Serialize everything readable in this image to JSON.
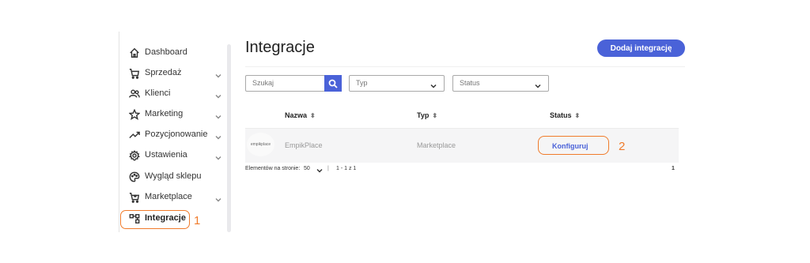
{
  "sidebar": {
    "items": [
      {
        "label": "Dashboard",
        "icon": "home-icon",
        "chevron": false
      },
      {
        "label": "Sprzedaż",
        "icon": "cart-icon",
        "chevron": true
      },
      {
        "label": "Klienci",
        "icon": "users-icon",
        "chevron": true
      },
      {
        "label": "Marketing",
        "icon": "star-icon",
        "chevron": true
      },
      {
        "label": "Pozycjonowanie",
        "icon": "trending-up-icon",
        "chevron": true
      },
      {
        "label": "Ustawienia",
        "icon": "gear-icon",
        "chevron": true
      },
      {
        "label": "Wygląd sklepu",
        "icon": "palette-icon",
        "chevron": false
      },
      {
        "label": "Marketplace",
        "icon": "marketplace-cart-icon",
        "chevron": true
      },
      {
        "label": "Integracje",
        "icon": "integrations-icon",
        "chevron": false,
        "active": true
      }
    ],
    "annotation": "1"
  },
  "main": {
    "title": "Integracje",
    "add_button": "Dodaj integrację",
    "filters": {
      "search_placeholder": "Szukaj",
      "type_placeholder": "Typ",
      "status_placeholder": "Status"
    },
    "table": {
      "headers": [
        "Nazwa",
        "Typ",
        "Status"
      ],
      "rows": [
        {
          "logo_text": "empikplace",
          "name": "EmpikPlace",
          "type": "Marketplace",
          "action": "Konfiguruj"
        }
      ]
    },
    "annotation": "2",
    "pagination": {
      "label": "Elementów na stronie:",
      "per_page": "50",
      "separator": "|",
      "range": "1 - 1 z 1",
      "page": "1"
    }
  },
  "colors": {
    "accent": "#4a62d8",
    "highlight": "#f07b2b"
  }
}
